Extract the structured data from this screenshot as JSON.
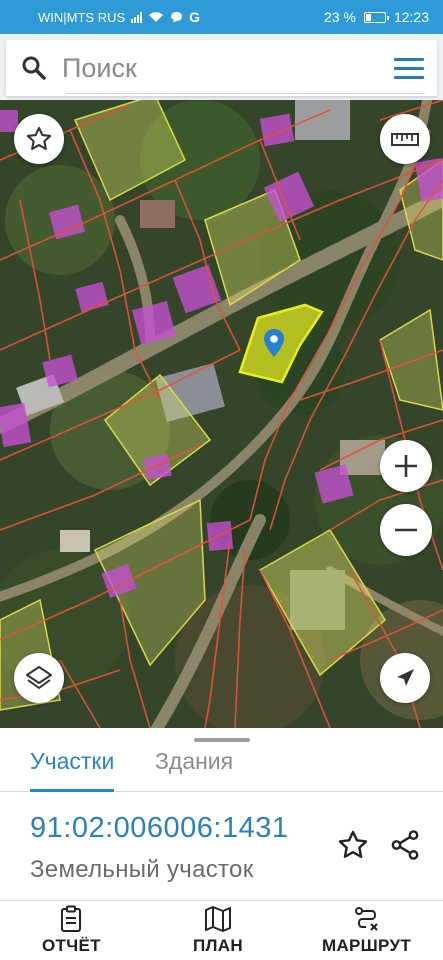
{
  "status_bar": {
    "carrier": "WIN|MTS RUS",
    "battery": "23 %",
    "battery_level": 0.23,
    "time": "12:23"
  },
  "search": {
    "placeholder": "Поиск"
  },
  "icons": {
    "search": "search-icon",
    "menu": "hamburger-menu-icon",
    "favorite": "star-icon",
    "ruler": "ruler-icon",
    "layers": "layers-icon",
    "location": "navigation-arrow-icon",
    "zoom_in": "plus-icon",
    "zoom_out": "minus-icon",
    "pin": "map-pin-icon",
    "share": "share-icon",
    "report": "clipboard-icon",
    "plan": "map-icon",
    "route": "route-icon"
  },
  "colors": {
    "accent": "#2a85c5",
    "status_bar": "#2e9bd6",
    "parcel_border": "#e0533a",
    "selected_parcel": "#e7ee1e",
    "building": "#c74fd3",
    "highlight_parcel": "#e9ee6a"
  },
  "tabs": [
    {
      "label": "Участки",
      "active": true
    },
    {
      "label": "Здания",
      "active": false
    }
  ],
  "selected_object": {
    "cadastral_number": "91:02:006006:1431",
    "type": "Земельный участок"
  },
  "bottom_nav": [
    {
      "label": "ОТЧЁТ"
    },
    {
      "label": "ПЛАН"
    },
    {
      "label": "МАРШРУТ"
    }
  ]
}
